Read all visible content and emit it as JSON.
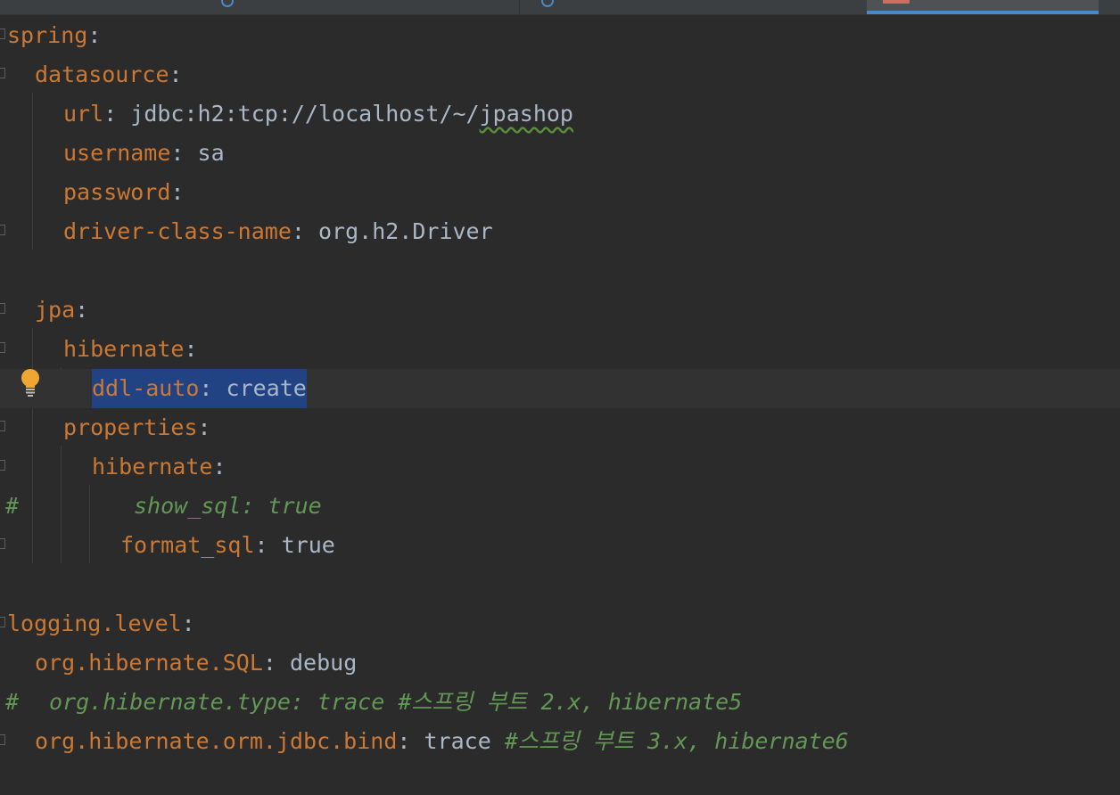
{
  "editor": {
    "lines": {
      "l1": {
        "key": "spring",
        "colon": ":"
      },
      "l2": {
        "key": "datasource",
        "colon": ":"
      },
      "l3": {
        "key": "url",
        "colon": ": ",
        "value_a": "jdbc:h2:tcp://localhost/~/",
        "value_b": "jpashop"
      },
      "l4": {
        "key": "username",
        "colon": ": ",
        "value": "sa"
      },
      "l5": {
        "key": "password",
        "colon": ":"
      },
      "l6": {
        "key": "driver-class-name",
        "colon": ": ",
        "value": "org.h2.Driver"
      },
      "l8": {
        "key": "jpa",
        "colon": ":"
      },
      "l9": {
        "key": "hibernate",
        "colon": ":"
      },
      "l10": {
        "key": "ddl-auto",
        "colon": ": ",
        "value": "create"
      },
      "l11": {
        "key": "properties",
        "colon": ":"
      },
      "l12": {
        "key": "hibernate",
        "colon": ":"
      },
      "l13": {
        "hash": "#",
        "text": "show_sql: true"
      },
      "l14": {
        "key": "format_sql",
        "colon": ": ",
        "value": "true"
      },
      "l16": {
        "key": "logging.level",
        "colon": ":"
      },
      "l17": {
        "key": "org.hibernate.SQL",
        "colon": ": ",
        "value": "debug"
      },
      "l18": {
        "hash": "#",
        "text": "org.hibernate.type: trace #스프링 부트 2.x, hibernate5"
      },
      "l19": {
        "key": "org.hibernate.orm.jdbc.bind",
        "colon": ": ",
        "value": "trace ",
        "comment": "#스프링 부트 3.x, hibernate6"
      }
    }
  },
  "colors": {
    "background": "#2b2b2b",
    "key": "#cc7832",
    "value": "#a9b7c6",
    "comment": "#629755",
    "selection": "#214283",
    "current_line": "#323232",
    "tab_accent": "#4a88c7"
  },
  "icons": {
    "intention": "lightbulb-icon",
    "tab": "yaml-file-icon"
  }
}
